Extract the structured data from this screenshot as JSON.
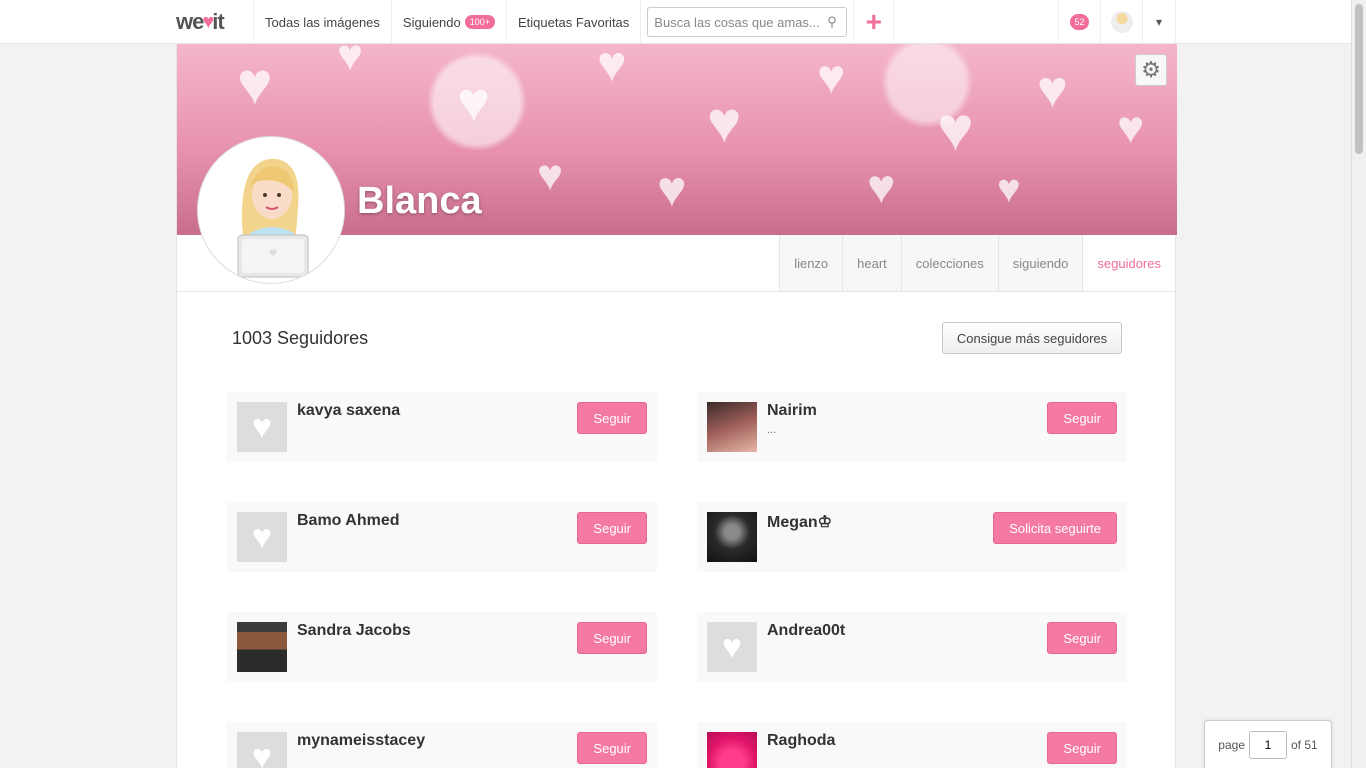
{
  "nav": {
    "logo_left": "we",
    "logo_right": "it",
    "items": [
      {
        "label": "Todas las imágenes"
      },
      {
        "label": "Siguiendo",
        "badge": "100+"
      },
      {
        "label": "Etiquetas Favoritas"
      }
    ],
    "search_placeholder": "Busca las cosas que amas...",
    "plus": "+",
    "notifications": "52",
    "caret": "▾"
  },
  "profile": {
    "name": "Blanca",
    "settings_icon": "gear-icon",
    "tabs": [
      "lienzo",
      "heart",
      "colecciones",
      "siguiendo",
      "seguidores"
    ],
    "active_tab": "seguidores"
  },
  "followers": {
    "count_text": "1003 Seguidores",
    "more_button": "Consigue más seguidores",
    "list": [
      {
        "name": "kavya saxena",
        "sub": "",
        "button": "Seguir",
        "avatar": "placeholder"
      },
      {
        "name": "Nairim",
        "sub": "...",
        "button": "Seguir",
        "avatar": "photo"
      },
      {
        "name": "Bamo Ahmed",
        "sub": "",
        "button": "Seguir",
        "avatar": "placeholder"
      },
      {
        "name": "Megan♔",
        "sub": "",
        "button": "Solicita seguirte",
        "avatar": "photo"
      },
      {
        "name": "Sandra Jacobs",
        "sub": "",
        "button": "Seguir",
        "avatar": "photo"
      },
      {
        "name": "Andrea00t",
        "sub": "",
        "button": "Seguir",
        "avatar": "placeholder"
      },
      {
        "name": "mynameisstacey",
        "sub": "",
        "button": "Seguir",
        "avatar": "placeholder"
      },
      {
        "name": "Raghoda",
        "sub": "",
        "button": "Seguir",
        "avatar": "photo"
      }
    ]
  },
  "pager": {
    "label": "page",
    "current": "1",
    "total": "of 51"
  }
}
